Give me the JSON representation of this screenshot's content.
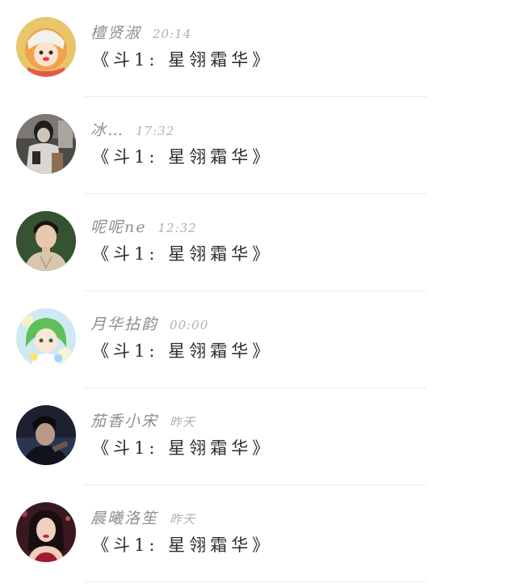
{
  "contacts": [
    {
      "name": "檀贤淑",
      "time": "20:14",
      "message": "《斗1: 星翎霜华》",
      "avatar_icon": "anime-girl-avatar-icon"
    },
    {
      "name": "冰…",
      "time": "17:32",
      "message": "《斗1: 星翎霜华》",
      "avatar_icon": "mirror-selfie-avatar-icon"
    },
    {
      "name": "呢呢ne",
      "time": "12:32",
      "message": "《斗1: 星翎霜华》",
      "avatar_icon": "man-portrait-avatar-icon"
    },
    {
      "name": "月华拈韵",
      "time": "00:00",
      "message": "《斗1: 星翎霜华》",
      "avatar_icon": "green-hair-anime-avatar-icon"
    },
    {
      "name": "茄香小宋",
      "time": "昨天",
      "message": "《斗1: 星翎霜华》",
      "avatar_icon": "dark-portrait-avatar-icon"
    },
    {
      "name": "晨曦洛笙",
      "time": "昨天",
      "message": "《斗1: 星翎霜华》",
      "avatar_icon": "woman-portrait-avatar-icon"
    }
  ]
}
